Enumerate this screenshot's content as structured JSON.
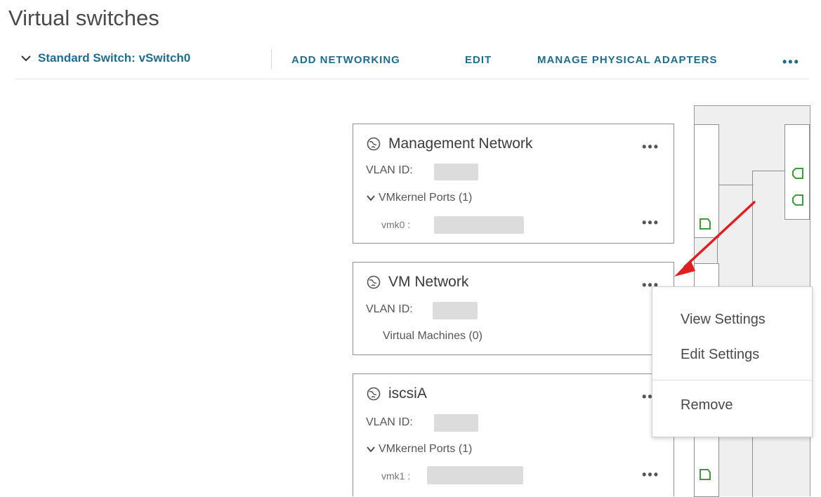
{
  "page": {
    "title": "Virtual switches"
  },
  "toolbar": {
    "switch_title": "Standard Switch: vSwitch0",
    "add_networking": "ADD NETWORKING",
    "edit": "EDIT",
    "manage_adapters": "MANAGE PHYSICAL ADAPTERS",
    "more": "•••"
  },
  "cards": [
    {
      "title": "Management Network",
      "vlan_label": "VLAN ID:",
      "section_label": "VMkernel Ports (1)",
      "port_label": "vmk0 :",
      "more": "•••"
    },
    {
      "title": "VM Network",
      "vlan_label": "VLAN ID:",
      "section_label": "Virtual Machines (0)",
      "more": "•••"
    },
    {
      "title": "iscsiA",
      "vlan_label": "VLAN ID:",
      "section_label": "VMkernel Ports (1)",
      "port_label": "vmk1 :",
      "more": "•••"
    }
  ],
  "context_menu": {
    "view_settings": "View Settings",
    "edit_settings": "Edit Settings",
    "remove": "Remove"
  },
  "colors": {
    "link": "#1f6d8c",
    "annotation_arrow": "#e02020",
    "port_icon": "#3e9a3e"
  }
}
